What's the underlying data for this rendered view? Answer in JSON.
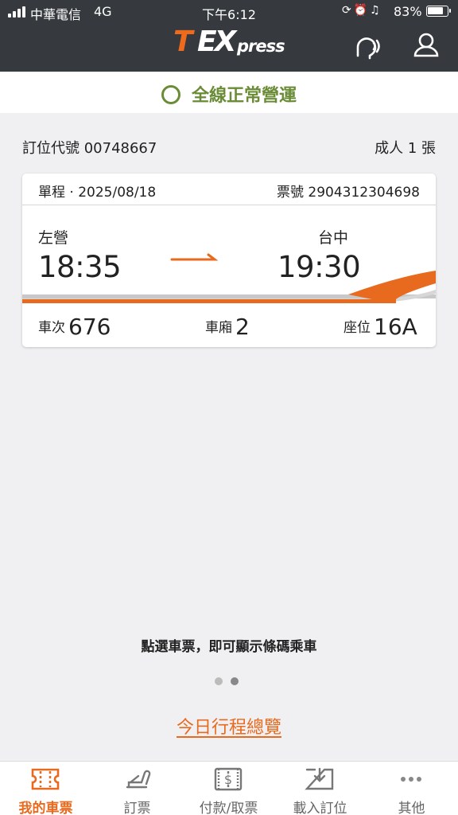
{
  "status_bar": {
    "carrier": "中華電信",
    "network": "4G",
    "time": "下午6:12",
    "battery_pct": "83%",
    "battery_level": 0.83
  },
  "header": {
    "logo_t": "T",
    "logo_ex": "EX",
    "logo_press": "press",
    "icons": [
      "voice-assist-icon",
      "account-icon"
    ]
  },
  "service_status": {
    "text": "全線正常營運",
    "color": "#6a8c36"
  },
  "booking": {
    "code_label": "訂位代號 00748667",
    "passengers": "成人 1 張"
  },
  "ticket": {
    "trip": "單程 · 2025/08/18",
    "ticket_no": "票號 2904312304698",
    "from_station": "左營",
    "from_time": "18:35",
    "to_station": "台中",
    "to_time": "19:30",
    "train_label": "車次",
    "train_no": "676",
    "car_label": "車廂",
    "car_no": "2",
    "seat_label": "座位",
    "seat_no": "16A"
  },
  "hint": "點選車票，即可顯示條碼乘車",
  "pager": {
    "count": 2,
    "active": 1
  },
  "overview_link": "今日行程總覽",
  "tabs": [
    {
      "label": "我的車票",
      "icon": "ticket-icon",
      "active": true
    },
    {
      "label": "訂票",
      "icon": "seat-icon",
      "active": false
    },
    {
      "label": "付款/取票",
      "icon": "payment-icon",
      "active": false
    },
    {
      "label": "載入訂位",
      "icon": "download-icon",
      "active": false
    },
    {
      "label": "其他",
      "icon": "more-icon",
      "active": false
    }
  ],
  "colors": {
    "accent": "#e86a1e",
    "header_bg": "#36393e",
    "ok_green": "#6a8c36",
    "page_bg": "#f0f0f2"
  }
}
